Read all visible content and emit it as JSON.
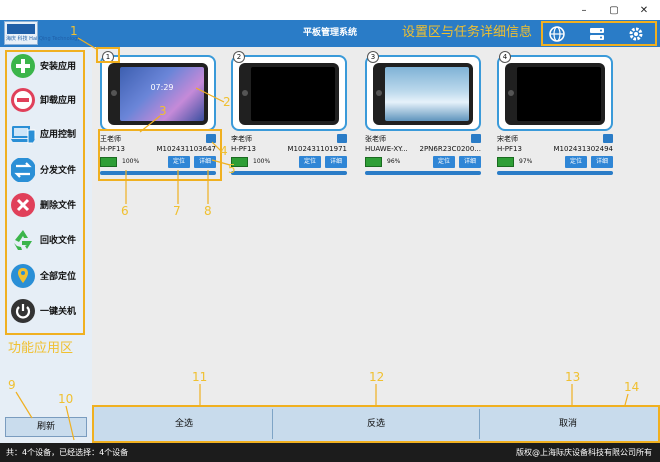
{
  "window": {
    "minimize": "–",
    "maximize": "▢",
    "close": "✕"
  },
  "header": {
    "title": "平板管理系统",
    "annotation": "设置区与任务详细信息",
    "logo_text": "海庆 科技 Hai Qing Technology"
  },
  "sidebar": {
    "items": [
      {
        "label": "安装应用",
        "icon": "plus-icon",
        "color": "#3bb54a"
      },
      {
        "label": "卸载应用",
        "icon": "minus-icon",
        "color": "#e0405a"
      },
      {
        "label": "应用控制",
        "icon": "laptop-icon",
        "color": "#2a8fd6"
      },
      {
        "label": "分发文件",
        "icon": "transfer-icon",
        "color": "#2a8fd6"
      },
      {
        "label": "删除文件",
        "icon": "delete-icon",
        "color": "#e0405a"
      },
      {
        "label": "回收文件",
        "icon": "recycle-icon",
        "color": "#3bb54a"
      },
      {
        "label": "全部定位",
        "icon": "location-icon",
        "color": "#2a8fd6"
      },
      {
        "label": "一键关机",
        "icon": "power-icon",
        "color": "#333333"
      }
    ],
    "annotation": "功能应用区",
    "refresh_label": "刷新"
  },
  "devices": [
    {
      "index": "1",
      "teacher": "王老师",
      "model": "H-PF13",
      "serial": "M102431103647",
      "battery": "100%",
      "locate": "定位",
      "detail": "详细",
      "progress": 1.0,
      "screen": "wallpaper",
      "time": "07:29"
    },
    {
      "index": "2",
      "teacher": "李老师",
      "model": "H-PF13",
      "serial": "M102431101971",
      "battery": "100%",
      "locate": "定位",
      "detail": "详细",
      "progress": 1.0,
      "screen": "black",
      "time": ""
    },
    {
      "index": "3",
      "teacher": "张老师",
      "model": "HUAWE-XY...",
      "serial": "2PN6R23C0200...",
      "battery": "96%",
      "locate": "定位",
      "detail": "详细",
      "progress": 1.0,
      "screen": "ice",
      "time": ""
    },
    {
      "index": "4",
      "teacher": "宋老师",
      "model": "H-PF13",
      "serial": "M102431302494",
      "battery": "97%",
      "locate": "定位",
      "detail": "详细",
      "progress": 1.0,
      "screen": "black",
      "time": ""
    }
  ],
  "annotations": {
    "n1": "1",
    "n2": "2",
    "n3": "3",
    "n4": "4",
    "n5": "5",
    "n6": "6",
    "n7": "7",
    "n8": "8",
    "n9": "9",
    "n10": "10",
    "n11": "11",
    "n12": "12",
    "n13": "13",
    "n14": "14"
  },
  "actions": {
    "select_all": "全选",
    "invert": "反选",
    "cancel": "取消"
  },
  "status": {
    "summary": "共：4个设备，已经选择：4个设备",
    "copyright": "版权@上海际庆设备科技有限公司所有"
  },
  "colors": {
    "title_bar": "#2a7cc7",
    "highlight": "#f0b020",
    "annotation": "#f0c030",
    "accent": "#2f86d6"
  }
}
